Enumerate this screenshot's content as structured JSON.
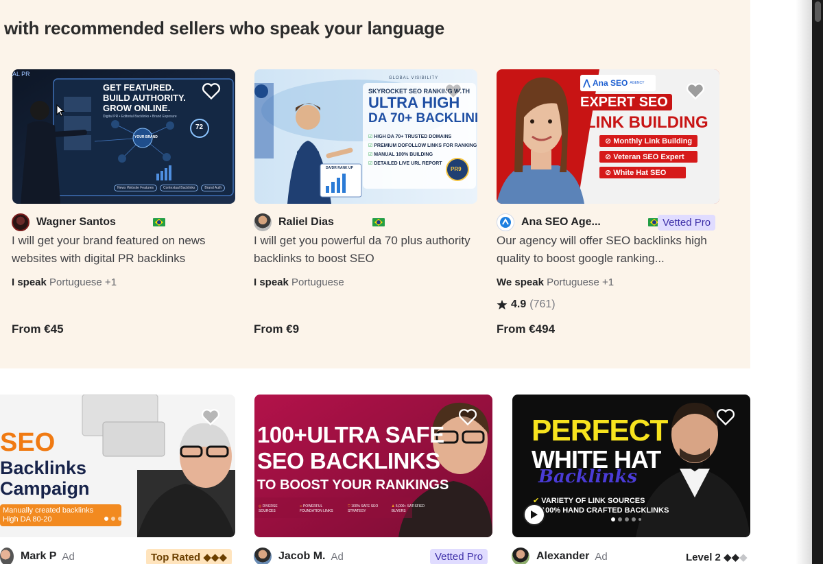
{
  "section_heading": "with recommended sellers who speak your language",
  "recommended_gigs": [
    {
      "seller": "Wagner Santos",
      "title": "I will get your brand featured on news websites with digital PR backlinks",
      "lang_prefix": "I speak",
      "languages": "Portuguese +1",
      "price": "From €45",
      "thumb": {
        "tag": "AL PR",
        "line1": "GET FEATURED.",
        "line2": "BUILD AUTHORITY.",
        "line3": "GROW ONLINE.",
        "sub": "Digital PR • Editorial Backlinks • Brand Exposure",
        "center": "YOUR BRAND",
        "score": "72",
        "chips": [
          "News Website Features",
          "Contextual Backlinks",
          "Brand Auth"
        ]
      }
    },
    {
      "seller": "Raliel Dias",
      "title": "I will get you powerful da 70 plus authority backlinks to boost SEO",
      "lang_prefix": "I speak",
      "languages": "Portuguese",
      "price": "From €9",
      "thumb": {
        "top": "GLOBAL VISIBILITY",
        "line1": "SKYROCKET SEO RANKING WITH",
        "line2": "ULTRA HIGH",
        "line3": "DA 70+ BACKLINI",
        "checks": [
          "HIGH DA 70+ TRUSTED DOMAINS",
          "PREMIUM DOFOLLOW LINKS FOR RANKING",
          "MANUAL 100% BUILDING",
          "DETAILED LIVE URL REPORT"
        ],
        "badge": "PR9",
        "chart_label": "DA/DR RANK UP"
      }
    },
    {
      "seller": "Ana SEO Age...",
      "badge": "Vetted Pro",
      "title": "Our agency will offer SEO backlinks high quality to boost google ranking...",
      "lang_prefix": "We speak",
      "languages": "Portuguese +1",
      "rating": "4.9",
      "reviews": "(761)",
      "price": "From €494",
      "thumb": {
        "brand": "Ana SEO",
        "brand_sub": "AGENCY",
        "line1": "EXPERT SEO",
        "line2": "LINK BUILDING",
        "bullets": [
          "Monthly Link Building",
          "Veteran SEO Expert",
          "White Hat SEO"
        ]
      }
    }
  ],
  "ad_gigs": [
    {
      "seller": "Mark P",
      "ad_label": "Ad",
      "badge": "Top Rated ◆◆◆",
      "thumb": {
        "line1": "SEO",
        "line2": "Backlinks",
        "line3": "Campaign",
        "footer1": "Manually created backlinks",
        "footer2": "High DA 80-20"
      }
    },
    {
      "seller": "Jacob M.",
      "ad_label": "Ad",
      "badge": "Vetted Pro",
      "thumb": {
        "line1": "100+ULTRA SAFE",
        "line2": "SEO BACKLINKS",
        "line3": "TO BOOST YOUR RANKINGS",
        "features": [
          "DIVERSE SOURCES",
          "POWERFUL FOUNDATION LINKS",
          "100% SAFE SEO STRATEGY",
          "5,000+ SATISFIED BUYERS"
        ]
      }
    },
    {
      "seller": "Alexander",
      "ad_label": "Ad",
      "level": "Level 2",
      "level_diamonds": "◆◆",
      "level_dim": "◆",
      "thumb": {
        "line1": "PERFECT",
        "line2": "WHITE HAT",
        "line3": "Backlinks",
        "line4": "VARIETY OF LINK SOURCES",
        "line5": "100% HAND CRAFTED BACKLINKS"
      }
    }
  ],
  "colors": {
    "section_bg": "#fcf4ea",
    "vetted_bg": "#e0dcff",
    "top_rated_bg": "#ffe4bd"
  }
}
